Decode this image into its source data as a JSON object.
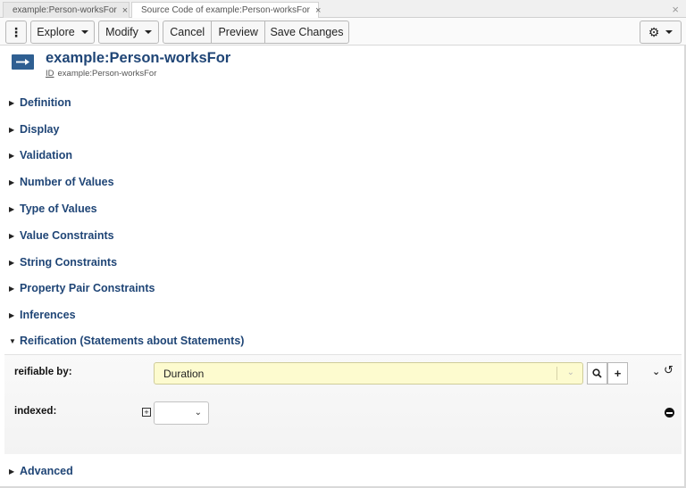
{
  "tabs": [
    {
      "label": "example:Person-worksFor",
      "close": "×"
    },
    {
      "label": "Source Code of example:Person-worksFor",
      "close": "×"
    }
  ],
  "window_close": "×",
  "toolbar": {
    "menu_icon": "⋮",
    "explore_label": "Explore",
    "modify_label": "Modify",
    "cancel_label": "Cancel",
    "preview_label": "Preview",
    "save_label": "Save Changes",
    "settings_icon": "⚙"
  },
  "header": {
    "title": "example:Person-worksFor",
    "id_label": "ID",
    "id_value": "example:Person-worksFor",
    "icon": "property-arrow-icon",
    "icon_color": "#2f5f92"
  },
  "sections": [
    {
      "label": "Definition",
      "expanded": false
    },
    {
      "label": "Display",
      "expanded": false
    },
    {
      "label": "Validation",
      "expanded": false
    },
    {
      "label": "Number of Values",
      "expanded": false
    },
    {
      "label": "Type of Values",
      "expanded": false
    },
    {
      "label": "Value Constraints",
      "expanded": false
    },
    {
      "label": "String Constraints",
      "expanded": false
    },
    {
      "label": "Property Pair Constraints",
      "expanded": false
    },
    {
      "label": "Inferences",
      "expanded": false
    },
    {
      "label": "Reification (Statements about Statements)",
      "expanded": true
    },
    {
      "label": "Advanced",
      "expanded": false
    }
  ],
  "reification": {
    "reifiable_label": "reifiable by:",
    "reifiable_value": "Duration",
    "indexed_label": "indexed:",
    "indexed_value": ""
  },
  "colors": {
    "title": "#1f4576",
    "combo_bg": "#fdfbcf"
  }
}
